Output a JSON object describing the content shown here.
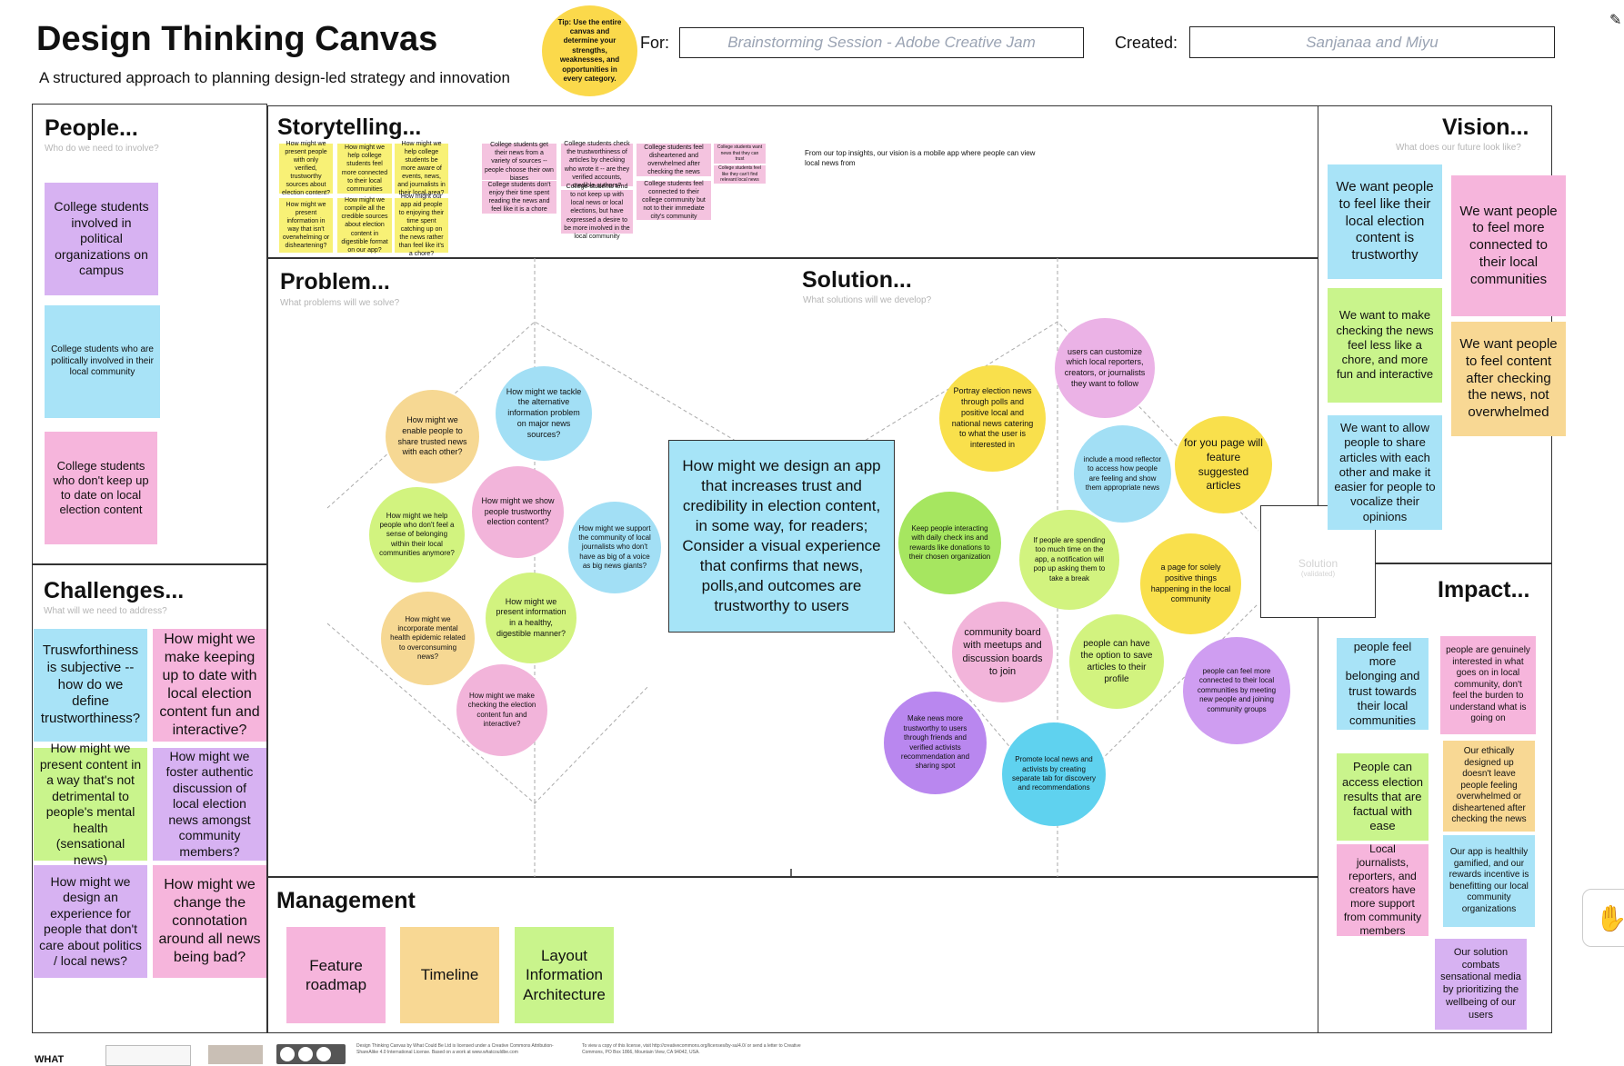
{
  "title": "Design Thinking Canvas",
  "subtitle": "A structured approach to planning design-led strategy and innovation",
  "tip": "Tip: Use the entire canvas and determine your strengths, weaknesses, and opportunities in every category.",
  "for_label": "For:",
  "for_value": "Brainstorming Session - Adobe Creative Jam",
  "created_label": "Created:",
  "created_value": "Sanjanaa and Miyu",
  "people": {
    "title": "People...",
    "hint": "Who do we need to involve?",
    "notes": [
      "College students involved in political organizations on campus",
      "College students who are politically involved in their local community",
      "College students who don't keep up to date on local election content"
    ]
  },
  "storytelling": {
    "title": "Storytelling...",
    "yellow_notes": [
      "How might we present people with only verified, trustworthy sources about election content?",
      "How might we help college students feel more connected to their local communities",
      "How might we help college students be more aware of events, news, and journalists in their local area?",
      "How might we present information in way that isn't overwhelming or disheartening?",
      "How might we compile all the credible sources about election content in digestible format on our app?",
      "How might our app aid people to enjoying their time spent catching up on the news rather than feel like it's a chore?"
    ],
    "pink_notes": [
      "College students get their news from a variety of sources -- people choose their own biases",
      "College students check the trustworthiness of articles by checking who wrote it -- are they verified accounts, credible authors?",
      "College students feel disheartened and overwhelmed after checking the news",
      "College students don't enjoy their time spent reading the news and feel like it is a chore",
      "College students tend to not keep up with local news or local elections, but have expressed a desire to be more involved in the local community",
      "College students feel connected to their college community but not to their immediate city's community",
      "College students want news that they can trust",
      "College students feel like they can't find relevant local news"
    ],
    "vision_text": "From our top insights, our vision is a mobile app where people can view local news from"
  },
  "problem": {
    "title": "Problem...",
    "hint": "What problems will we solve?",
    "circles": [
      "How might we enable people to share trusted news with each other?",
      "How might we tackle the alternative information problem on major news sources?",
      "How might we help people who don't feel a sense of belonging within their local communities anymore?",
      "How might we show people trustworthy election content?",
      "How might we support the community of local journalists who don't have as big of a voice as big news giants?",
      "How might we present information in a healthy, digestible manner?",
      "How might we incorporate mental health epidemic related to overconsuming news?",
      "How might we make checking the election content fun and interactive?"
    ]
  },
  "solution": {
    "title": "Solution...",
    "hint": "What solutions will we develop?",
    "circles": [
      "Portray election news through polls and positive local and national news catering to what the user is interested in",
      "users can customize which local reporters, creators, or journalists they want to follow",
      "include a mood reflector to access how people are feeling and show them appropriate news",
      "for you page will feature suggested articles",
      "Keep people interacting with daily check ins and rewards like donations to their chosen organization",
      "If people are spending too much time on the app, a notification will pop up asking them to take a break",
      "a page for solely positive things happening in the local community",
      "community board with meetups and discussion boards to join",
      "people can have the option to save articles to their profile",
      "people can feel more connected to their local communities by meeting new people and joining community groups",
      "Make news more trustworthy to users through friends and verified activists recommendation and sharing spot",
      "Promote local news and activists by creating separate tab for discovery and recommendations"
    ]
  },
  "center_question": "How might we design an app that increases trust and credibility in election content, in some way, for readers; Consider a visual experience that confirms that news, polls,and outcomes are trustworthy to users",
  "solution_box_label": "Solution",
  "solution_box_hint": "(validated)",
  "vision": {
    "title": "Vision...",
    "hint": "What does our future look like?",
    "notes": [
      "We want people to feel like their local election content is trustworthy",
      "We want people to feel more connected to their local communities",
      "We want to make checking the news feel less like a chore, and more fun and interactive",
      "We want people to feel content after checking the news, not overwhelmed",
      "We want to allow people to share articles with each other and make it easier for people to vocalize their opinions"
    ]
  },
  "challenges": {
    "title": "Challenges...",
    "hint": "What will we need to address?",
    "notes": [
      "Truswforthiness is subjective -- how do we define trustworthiness?",
      "How might we make keeping up to date with local election content fun and interactive?",
      "How might we present content in a way that's not detrimental to people's mental health (sensational news)",
      "How might we foster authentic discussion of local election news amongst community members?",
      "How might we design an experience for people that don't care about politics / local news?",
      "How might we change the connotation around all news being bad?"
    ]
  },
  "impact": {
    "title": "Impact...",
    "notes": [
      "people feel more belonging and trust towards their local communities",
      "people are genuinely interested in what goes on in local community, don't feel the burden to understand what is going on",
      "People can access election results that are factual with ease",
      "Our ethically designed up doesn't leave people feeling overwhelmed or disheartened after checking the news",
      "Local journalists, reporters, and creators have more support from community members",
      "Our app is healthily gamified, and our rewards incentive is benefitting our local community organizations",
      "Our solution combats sensational media by prioritizing the wellbeing of our users"
    ]
  },
  "management": {
    "title": "Management",
    "notes": [
      "Feature roadmap",
      "Timeline",
      "Layout Information Architecture"
    ]
  },
  "footer": {
    "logo_text": "WHAT",
    "license_text": "Design Thinking Canvas by What Could Be Ltd is licensed under a Creative Commons Attribution-ShareAlike 4.0 International License. Based on a work at www.whatcouldbe.com",
    "license_text2": "To view a copy of this license, visit http://creativecommons.org/licenses/by-sa/4.0/ or send a letter to Creative Commons, PO Box 1866, Mountain View, CA 94042, USA."
  }
}
